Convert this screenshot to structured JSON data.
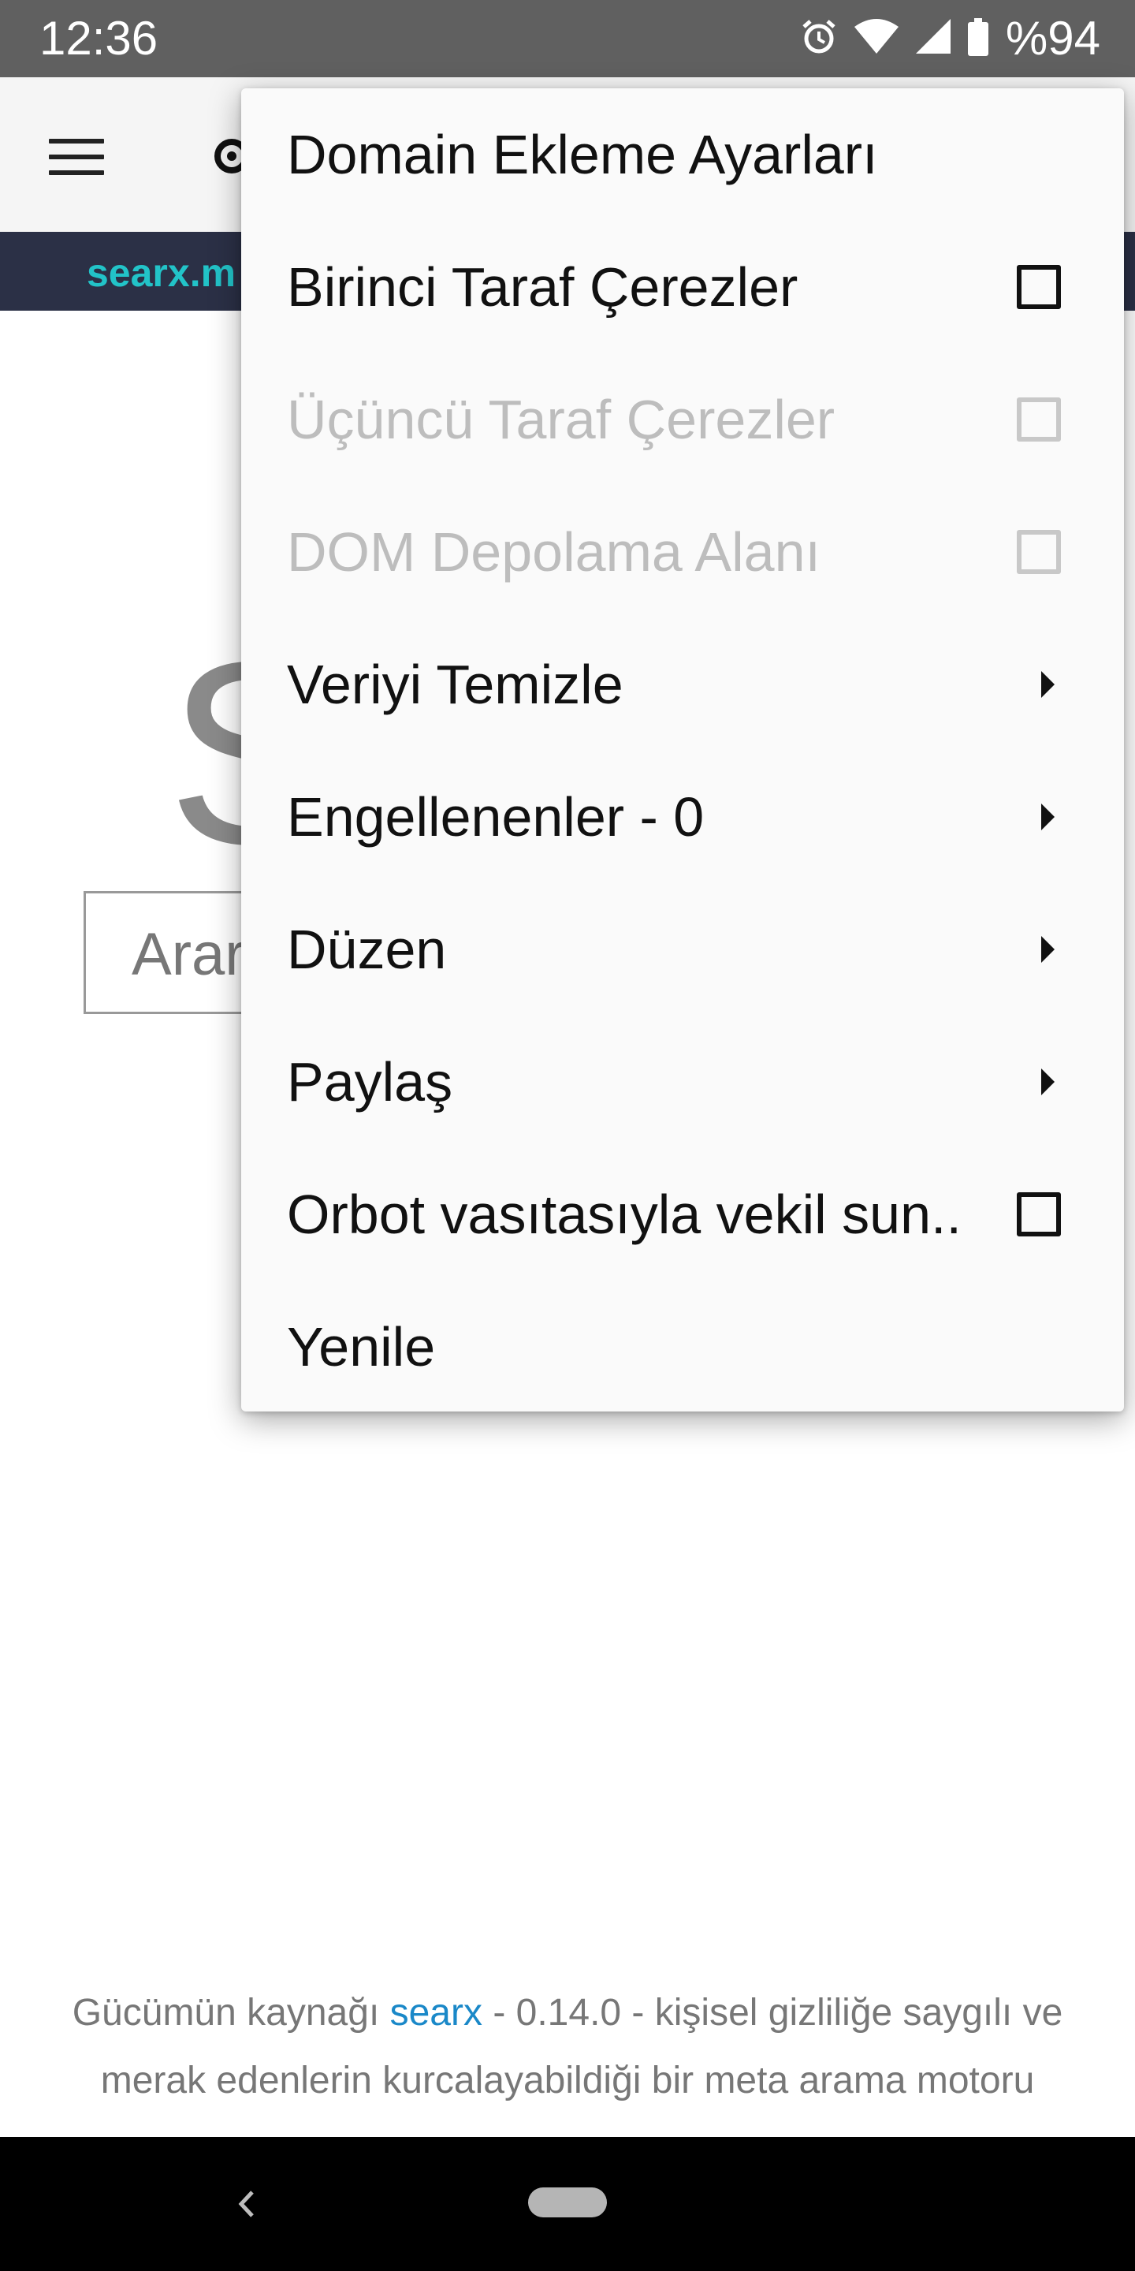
{
  "status_bar": {
    "time": "12:36",
    "battery": "%94",
    "icons": [
      "alarm-icon",
      "wifi-icon",
      "signal-icon",
      "battery-icon"
    ]
  },
  "app_bar": {
    "url": "searx.m"
  },
  "page": {
    "logo_letter": "S",
    "search_placeholder": "Arar",
    "footer": {
      "prefix": "Gücümün kaynağı ",
      "link": "searx",
      "suffix": " - 0.14.0 - kişisel gizliliğe saygılı ve",
      "line2": "merak edenlerin kurcalayabildiği bir meta arama motoru"
    }
  },
  "menu": {
    "items": [
      {
        "label": "Domain Ekleme Ayarları",
        "control": "none",
        "enabled": true
      },
      {
        "label": "Birinci Taraf Çerezler",
        "control": "checkbox",
        "checked": false,
        "enabled": true
      },
      {
        "label": "Üçüncü Taraf Çerezler",
        "control": "checkbox",
        "checked": false,
        "enabled": false
      },
      {
        "label": "DOM Depolama Alanı",
        "control": "checkbox",
        "checked": false,
        "enabled": false
      },
      {
        "label": "Veriyi Temizle",
        "control": "submenu",
        "enabled": true
      },
      {
        "label": "Engellenenler - 0",
        "control": "submenu",
        "enabled": true
      },
      {
        "label": "Düzen",
        "control": "submenu",
        "enabled": true
      },
      {
        "label": "Paylaş",
        "control": "submenu",
        "enabled": true
      },
      {
        "label": "Orbot vasıtasıyla vekil sun..",
        "control": "checkbox",
        "checked": false,
        "enabled": true
      },
      {
        "label": "Yenile",
        "control": "none",
        "enabled": true
      }
    ]
  },
  "colors": {
    "status_bar": "#606060",
    "url_strip": "#2b3046",
    "url_text": "#22c3c8",
    "link": "#1a88c8"
  }
}
